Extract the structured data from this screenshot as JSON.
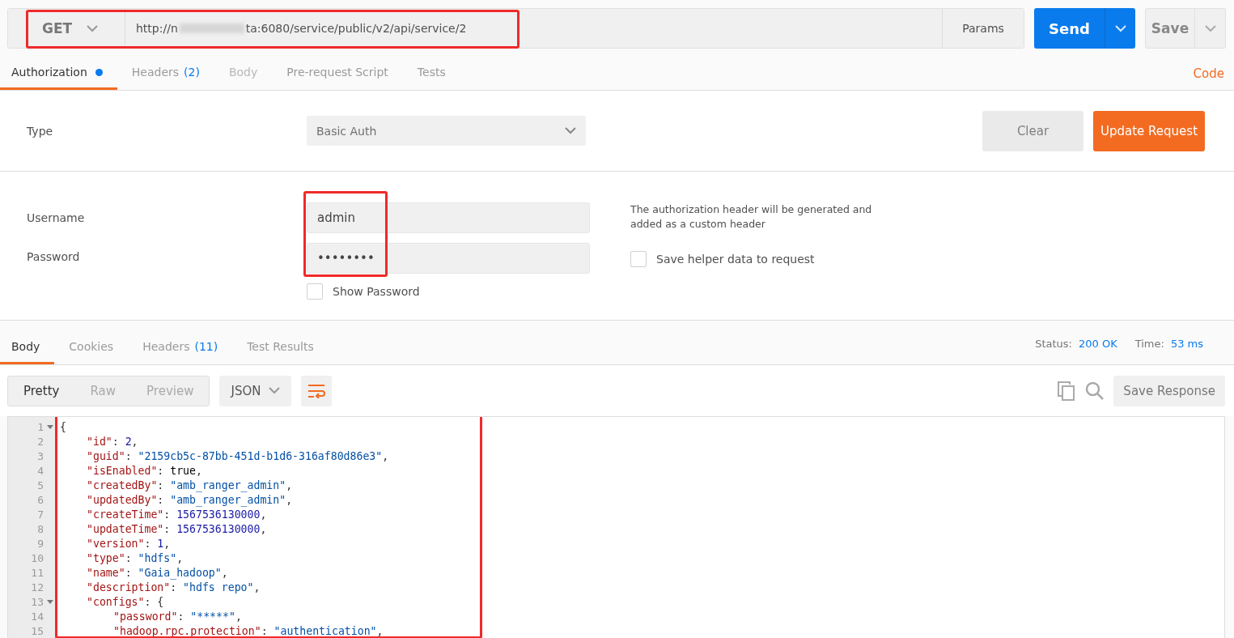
{
  "request": {
    "method": "GET",
    "url_start": "http://n",
    "url_redacted": true,
    "url_end": "ta:6080/service/public/v2/api/service/2",
    "highlighted": true,
    "params": "Params",
    "send": "Send",
    "save": "Save"
  },
  "request_tabs": [
    {
      "label": "Authorization",
      "dot": true,
      "selected": true,
      "disabled": false
    },
    {
      "label": "Headers",
      "count": "(2)",
      "dot": false,
      "selected": false,
      "disabled": false
    },
    {
      "label": "Body",
      "dot": false,
      "selected": false,
      "disabled": true
    },
    {
      "label": "Pre-request Script",
      "dot": false,
      "selected": false,
      "disabled": false
    },
    {
      "label": "Tests",
      "dot": false,
      "selected": false,
      "disabled": false
    }
  ],
  "code_link": "Code",
  "auth": {
    "type_label": "Type",
    "type_value": "Basic Auth",
    "clear": "Clear",
    "update": "Update Request",
    "username_label": "Username",
    "username": "admin",
    "password_label": "Password",
    "password": "••••••••",
    "highlighted": true,
    "show_password": {
      "label": "Show Password",
      "checked": false
    },
    "note": "The authorization header will be generated and added as a custom header",
    "save_helper": {
      "label": "Save helper data to request",
      "checked": false
    }
  },
  "response_tabs": [
    {
      "label": "Body",
      "selected": true
    },
    {
      "label": "Cookies",
      "selected": false
    },
    {
      "label": "Headers",
      "count": "(11)",
      "selected": false
    },
    {
      "label": "Test Results",
      "selected": false
    }
  ],
  "status": {
    "status_label": "Status:",
    "status_value": "200 OK",
    "time_label": "Time:",
    "time_value": "53 ms"
  },
  "view_modes": [
    {
      "label": "Pretty",
      "selected": true
    },
    {
      "label": "Raw",
      "selected": false
    },
    {
      "label": "Preview",
      "selected": false
    }
  ],
  "format": "JSON",
  "save_response": "Save Response",
  "body": {
    "highlighted": true,
    "lines": [
      {
        "number": "1",
        "expanded": true,
        "tokens": [
          {
            "kind": "punct",
            "text": "{"
          }
        ],
        "children": [
          {
            "number": "2",
            "tokens": [
              {
                "kind": "key",
                "text": "\"id\""
              },
              {
                "kind": "punct",
                "text": ": "
              },
              {
                "kind": "number",
                "text": "2"
              },
              {
                "kind": "punct",
                "text": ","
              }
            ]
          },
          {
            "number": "3",
            "tokens": [
              {
                "kind": "key",
                "text": "\"guid\""
              },
              {
                "kind": "punct",
                "text": ": "
              },
              {
                "kind": "string",
                "text": "\"2159cb5c-87bb-451d-b1d6-316af80d86e3\""
              },
              {
                "kind": "punct",
                "text": ","
              }
            ]
          },
          {
            "number": "4",
            "tokens": [
              {
                "kind": "key",
                "text": "\"isEnabled\""
              },
              {
                "kind": "punct",
                "text": ": "
              },
              {
                "kind": "literal",
                "text": "true"
              },
              {
                "kind": "punct",
                "text": ","
              }
            ]
          },
          {
            "number": "5",
            "tokens": [
              {
                "kind": "key",
                "text": "\"createdBy\""
              },
              {
                "kind": "punct",
                "text": ": "
              },
              {
                "kind": "string",
                "text": "\"amb_ranger_admin\""
              },
              {
                "kind": "punct",
                "text": ","
              }
            ]
          },
          {
            "number": "6",
            "tokens": [
              {
                "kind": "key",
                "text": "\"updatedBy\""
              },
              {
                "kind": "punct",
                "text": ": "
              },
              {
                "kind": "string",
                "text": "\"amb_ranger_admin\""
              },
              {
                "kind": "punct",
                "text": ","
              }
            ]
          },
          {
            "number": "7",
            "tokens": [
              {
                "kind": "key",
                "text": "\"createTime\""
              },
              {
                "kind": "punct",
                "text": ": "
              },
              {
                "kind": "number",
                "text": "1567536130000"
              },
              {
                "kind": "punct",
                "text": ","
              }
            ]
          },
          {
            "number": "8",
            "tokens": [
              {
                "kind": "key",
                "text": "\"updateTime\""
              },
              {
                "kind": "punct",
                "text": ": "
              },
              {
                "kind": "number",
                "text": "1567536130000"
              },
              {
                "kind": "punct",
                "text": ","
              }
            ]
          },
          {
            "number": "9",
            "tokens": [
              {
                "kind": "key",
                "text": "\"version\""
              },
              {
                "kind": "punct",
                "text": ": "
              },
              {
                "kind": "number",
                "text": "1"
              },
              {
                "kind": "punct",
                "text": ","
              }
            ]
          },
          {
            "number": "10",
            "tokens": [
              {
                "kind": "key",
                "text": "\"type\""
              },
              {
                "kind": "punct",
                "text": ": "
              },
              {
                "kind": "string",
                "text": "\"hdfs\""
              },
              {
                "kind": "punct",
                "text": ","
              }
            ]
          },
          {
            "number": "11",
            "tokens": [
              {
                "kind": "key",
                "text": "\"name\""
              },
              {
                "kind": "punct",
                "text": ": "
              },
              {
                "kind": "string",
                "text": "\"Gaia_hadoop\""
              },
              {
                "kind": "punct",
                "text": ","
              }
            ]
          },
          {
            "number": "12",
            "tokens": [
              {
                "kind": "key",
                "text": "\"description\""
              },
              {
                "kind": "punct",
                "text": ": "
              },
              {
                "kind": "string",
                "text": "\"hdfs repo\""
              },
              {
                "kind": "punct",
                "text": ","
              }
            ]
          },
          {
            "number": "13",
            "expanded": true,
            "tokens": [
              {
                "kind": "key",
                "text": "\"configs\""
              },
              {
                "kind": "punct",
                "text": ": {"
              }
            ],
            "children": [
              {
                "number": "14",
                "tokens": [
                  {
                    "kind": "key",
                    "text": "\"password\""
                  },
                  {
                    "kind": "punct",
                    "text": ": "
                  },
                  {
                    "kind": "string",
                    "text": "\"*****\""
                  },
                  {
                    "kind": "punct",
                    "text": ","
                  }
                ]
              },
              {
                "number": "15",
                "tokens": [
                  {
                    "kind": "key",
                    "text": "\"hadoop.rpc.protection\""
                  },
                  {
                    "kind": "punct",
                    "text": ": "
                  },
                  {
                    "kind": "string",
                    "text": "\"authentication\""
                  },
                  {
                    "kind": "punct",
                    "text": ","
                  }
                ]
              }
            ]
          }
        ]
      }
    ]
  }
}
